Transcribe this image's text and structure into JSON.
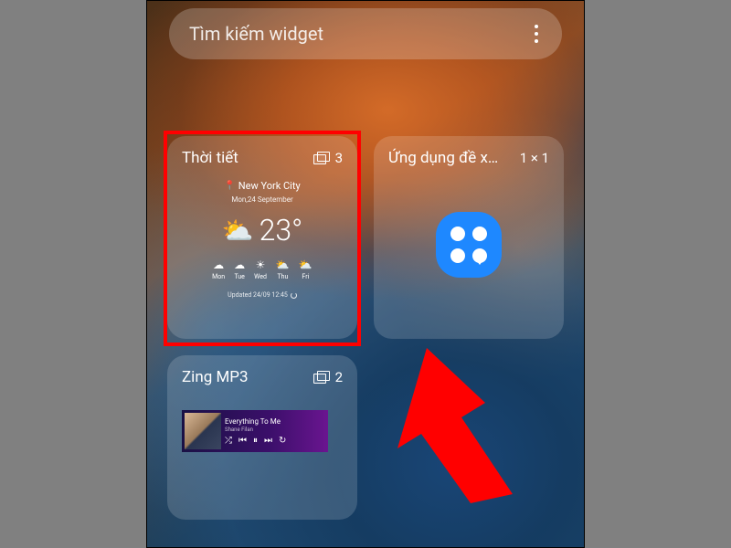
{
  "search": {
    "placeholder": "Tìm kiếm widget"
  },
  "widgets": {
    "weather": {
      "title": "Thời tiết",
      "count": "3",
      "location": "New York City",
      "date": "Mon,24 September",
      "temp": "23°",
      "forecast": [
        {
          "day": "Mon",
          "icon": "☁"
        },
        {
          "day": "Tue",
          "icon": "☁"
        },
        {
          "day": "Wed",
          "icon": "☀"
        },
        {
          "day": "Thu",
          "icon": "⛅"
        },
        {
          "day": "Fri",
          "icon": "⛅"
        }
      ],
      "updated": "Updated 24/09 12:45"
    },
    "suggested": {
      "title": "Ứng dụng đề x…",
      "size": "1 × 1"
    },
    "zing": {
      "title": "Zing MP3",
      "count": "2",
      "song": "Everything To Me",
      "artist": "Shane Filan"
    }
  }
}
